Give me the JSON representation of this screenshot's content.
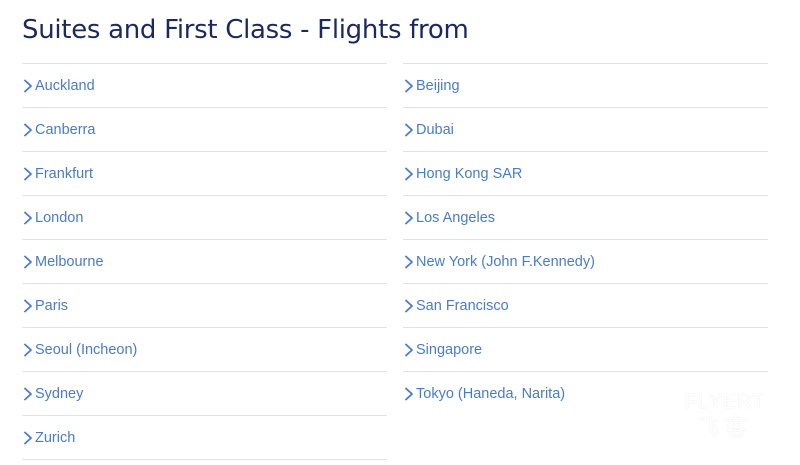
{
  "page": {
    "title": "Suites and First Class - Flights from"
  },
  "columns": {
    "left": [
      {
        "label": "Auckland"
      },
      {
        "label": "Canberra"
      },
      {
        "label": "Frankfurt"
      },
      {
        "label": "London"
      },
      {
        "label": "Melbourne"
      },
      {
        "label": "Paris"
      },
      {
        "label": "Seoul (Incheon)"
      },
      {
        "label": "Sydney"
      },
      {
        "label": "Zurich"
      }
    ],
    "right": [
      {
        "label": "Beijing"
      },
      {
        "label": "Dubai"
      },
      {
        "label": "Hong Kong SAR"
      },
      {
        "label": "Los Angeles"
      },
      {
        "label": "New York (John F.Kennedy)"
      },
      {
        "label": "San Francisco"
      },
      {
        "label": "Singapore"
      },
      {
        "label": "Tokyo (Haneda, Narita)"
      }
    ]
  },
  "watermark": {
    "brand": "FLYERT",
    "brand_cn": "飞客"
  },
  "colors": {
    "title": "#1b2a5e",
    "link": "#4a7cc4",
    "divider": "#e3e3e3"
  },
  "icons": {
    "row_icon": "chevron-right-icon"
  }
}
